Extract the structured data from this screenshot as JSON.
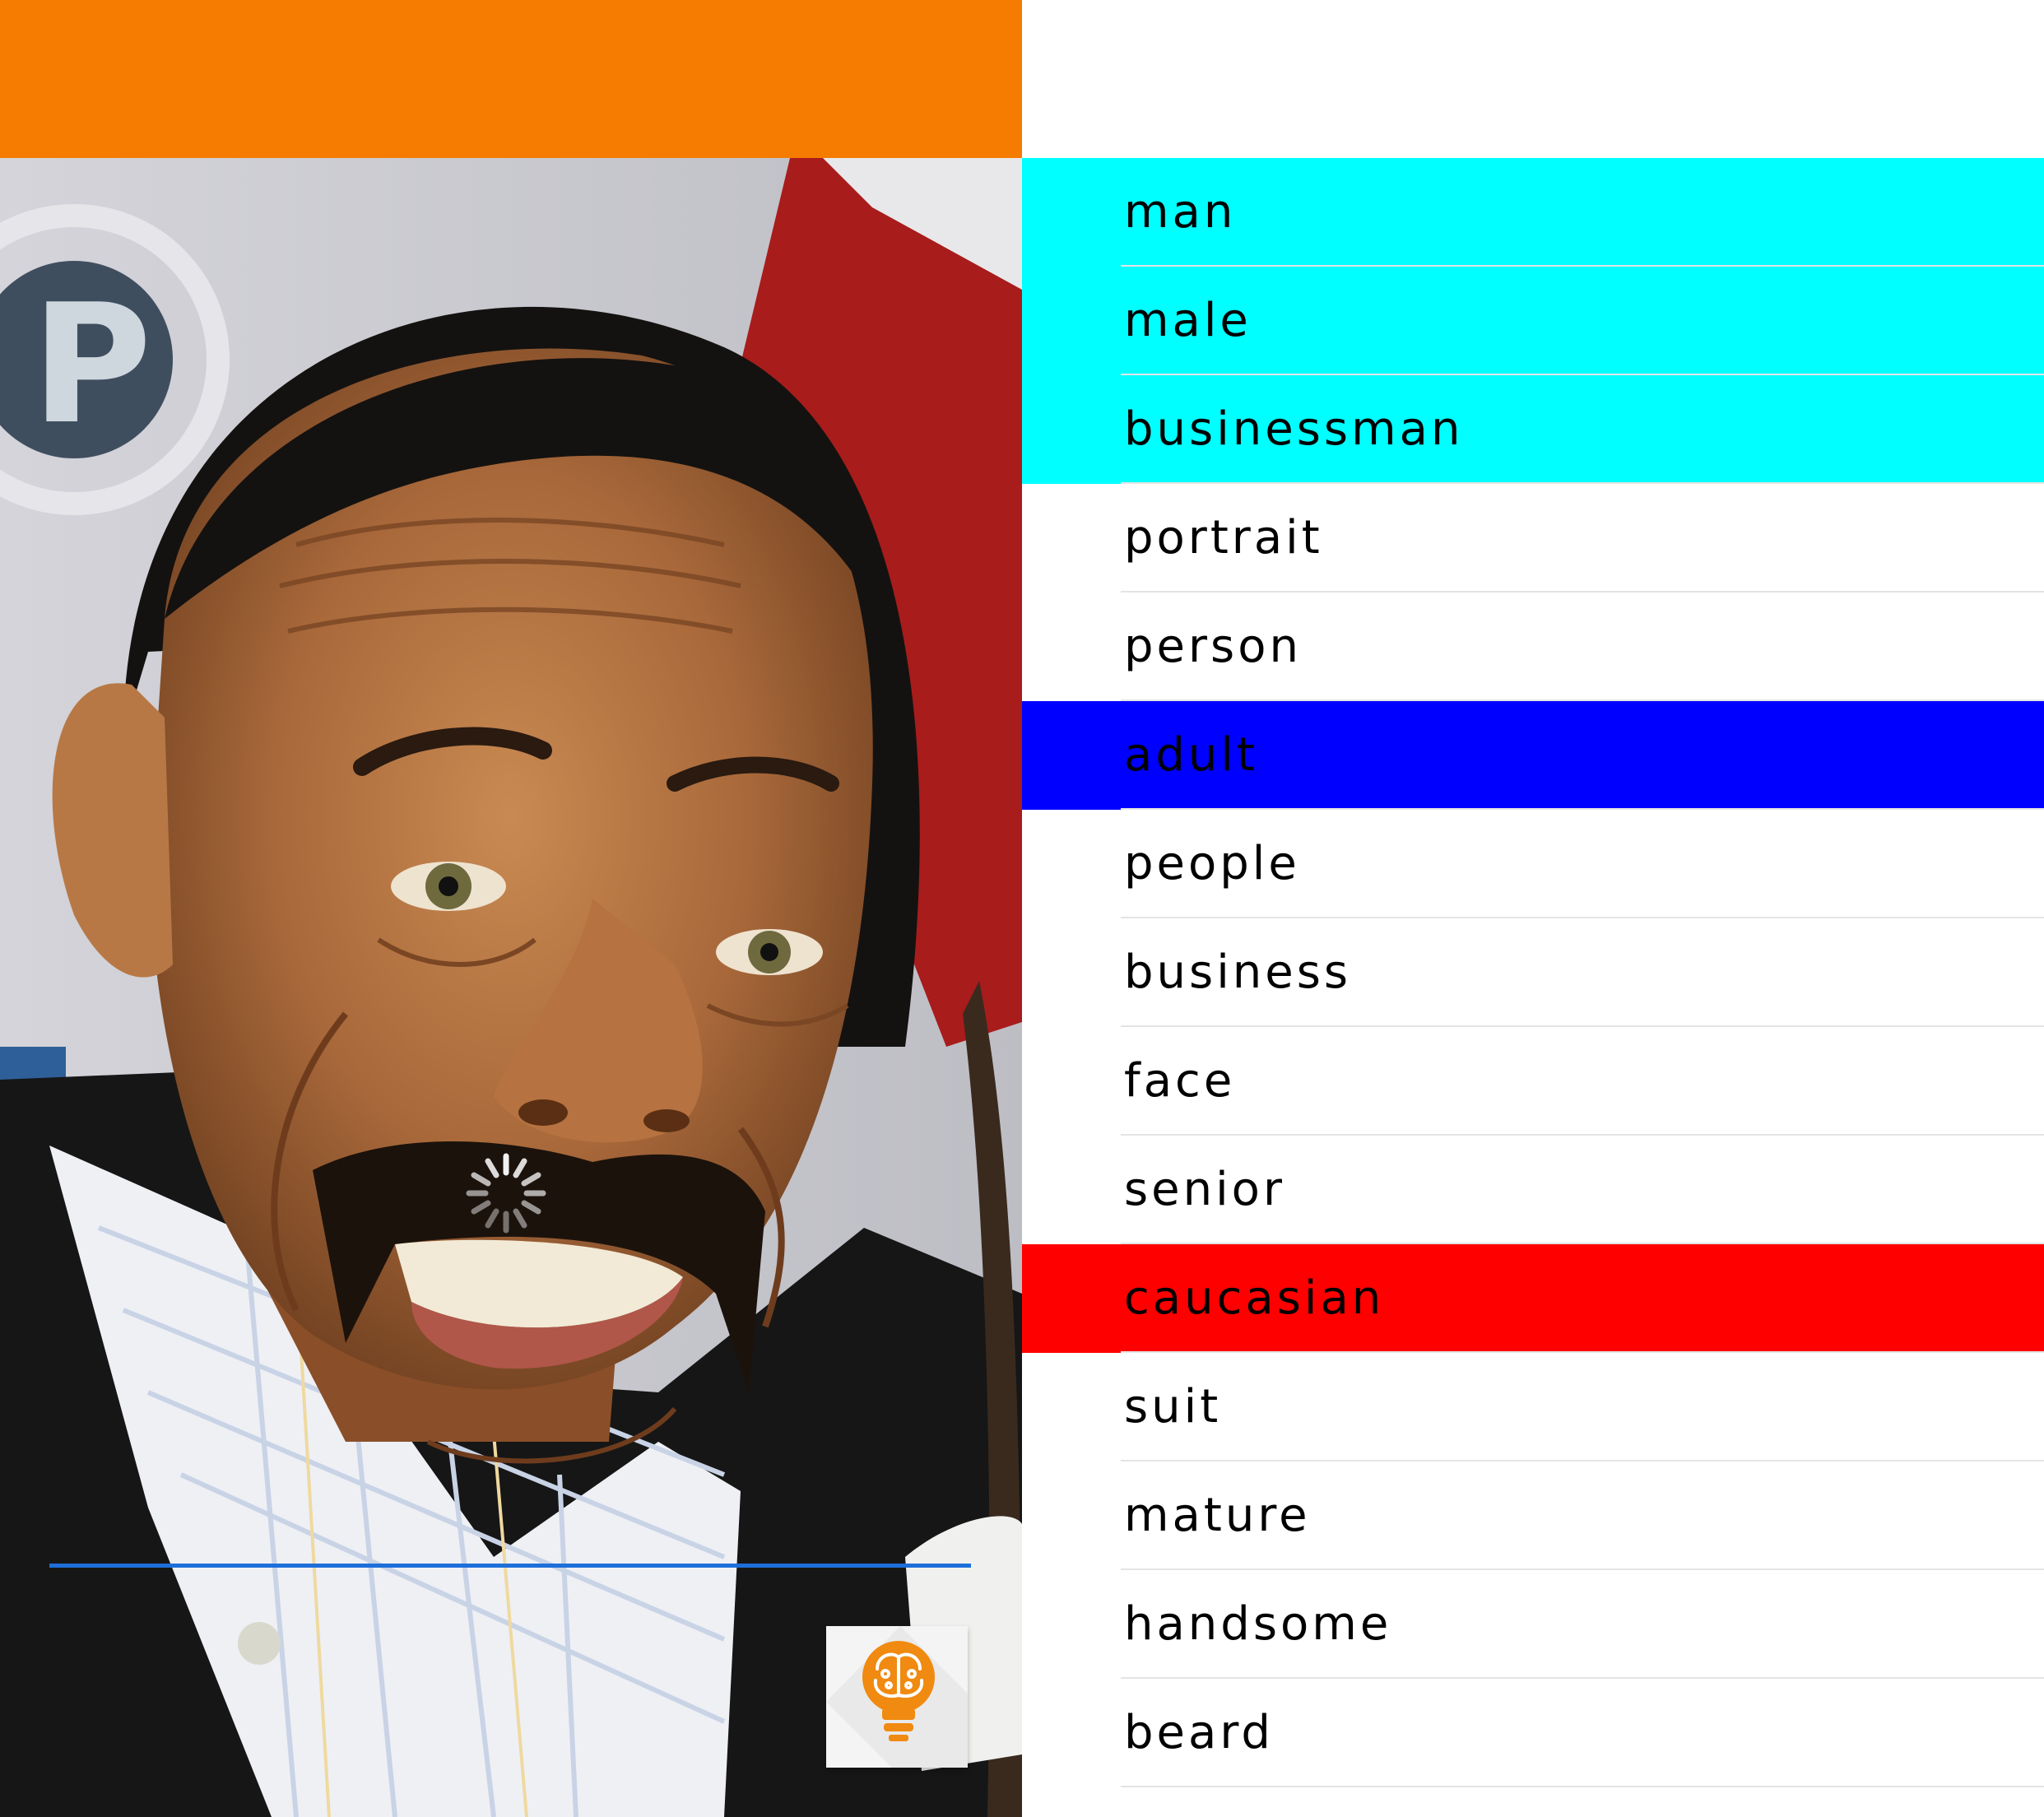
{
  "colors": {
    "app_bar": "#f57c00",
    "progress_line": "#1e6fd9",
    "bulb": "#f08a10"
  },
  "photo": {
    "description": "portrait-photo"
  },
  "fab": {
    "icon": "brain-lightbulb-icon"
  },
  "tags": [
    {
      "label": "man",
      "highlight": "#00ffff"
    },
    {
      "label": "male",
      "highlight": "#00ffff"
    },
    {
      "label": "businessman",
      "highlight": "#00ffff"
    },
    {
      "label": "portrait",
      "highlight": "#ffffff"
    },
    {
      "label": "person",
      "highlight": "#ffffff"
    },
    {
      "label": "adult",
      "highlight": "#0000ff"
    },
    {
      "label": "people",
      "highlight": "#ffffff"
    },
    {
      "label": "business",
      "highlight": "#ffffff"
    },
    {
      "label": "face",
      "highlight": "#ffffff"
    },
    {
      "label": "senior",
      "highlight": "#ffffff"
    },
    {
      "label": "caucasian",
      "highlight": "#ff0000"
    },
    {
      "label": "suit",
      "highlight": "#ffffff"
    },
    {
      "label": "mature",
      "highlight": "#ffffff"
    },
    {
      "label": "handsome",
      "highlight": "#ffffff"
    },
    {
      "label": "beard",
      "highlight": "#ffffff"
    }
  ]
}
